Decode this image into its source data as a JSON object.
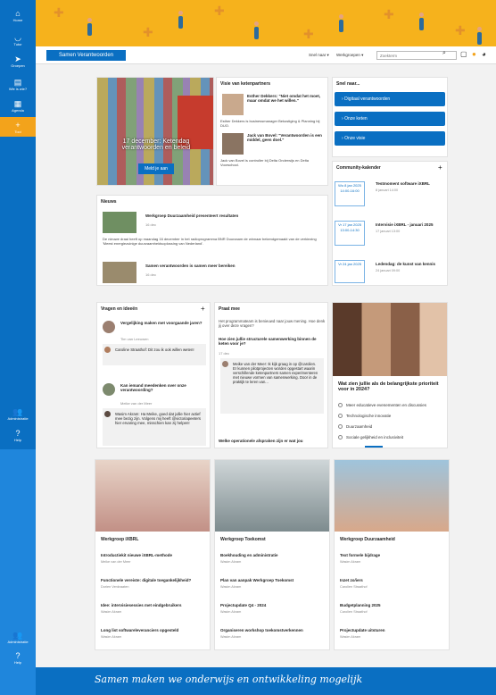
{
  "rail": {
    "items": [
      {
        "label": "Home",
        "icon": "home-icon",
        "glyph": "⌂"
      },
      {
        "label": "Tutor",
        "icon": "headset-icon",
        "glyph": "◡"
      },
      {
        "label": "Groepen",
        "icon": "send-icon",
        "glyph": "➤"
      },
      {
        "label": "Wie is wie?",
        "icon": "id-card-icon",
        "glyph": "▤"
      },
      {
        "label": "Agenda",
        "icon": "calendar-icon",
        "glyph": "▦"
      },
      {
        "label": "Tool",
        "icon": "plus-icon",
        "glyph": "+"
      }
    ],
    "admin_label": "Administratie",
    "help_label": "Help",
    "admin_label_2": "Administratie",
    "help_label_2": "Help",
    "active_color": "#f3a31b",
    "rail_color": "#0a6fc2"
  },
  "topbar": {
    "site_title": "Samen Verantwoorden",
    "snel_naar": "Snel naar ▾",
    "werkgroepen": "Werkgroepen ▾",
    "search_placeholder": "Zoekterm"
  },
  "hero": {
    "title": "17 december: Ketendag verantwoorden en beleid",
    "button": "Meld je aan"
  },
  "visie": {
    "heading": "Visie van ketenpartners",
    "q1": "Esther Dekkers: \"Niet omdat het moet, maar omdat we het willen.\"",
    "d1": "Esther Dekkers is businessmanager Bekostiging & Planning bij DUO.",
    "q2": "Jack van Bovel: \"Verantwoorden is een middel, geen doel.\"",
    "d2": "Jack van Bovel is controller bij Delta Onderwijs en Delta Voorschool."
  },
  "nieuws": {
    "heading": "Nieuws",
    "items": [
      {
        "title": "Werkgroep Duurzaamheid presenteert resultaten",
        "date": "16 dec",
        "excerpt": "De nieuwe draai heeft op maandag 16 december in het radioprogramma BNR Duurzaam de winnaar bekendgemaakt van de verkiezing 'Meest energiezuinige duurzaamheidsoplossing van Nederland'."
      },
      {
        "title": "Samen verantwoorden is samen meer bereiken",
        "date": "16 dec"
      }
    ]
  },
  "snel": {
    "heading": "Snel naar...",
    "buttons": [
      "Digitaal verantwoorden",
      "Onze keten",
      "Onze visie"
    ]
  },
  "kalender": {
    "heading": "Community-kalender",
    "events": [
      {
        "date": "Wo 8 jan 2025 14:00-16:00",
        "title": "Testmoment software iXBRL",
        "time": "8 januari 14:00"
      },
      {
        "date": "Vr 17 jan 2025 13:00-14:30",
        "title": "Intervisie iXBRL - januari 2025",
        "time": "17 januari 13:00"
      },
      {
        "date": "Vr 24 jan 2025",
        "title": "Ledendag: de kunst van kennis",
        "time": "24 januari 09:00"
      }
    ]
  },
  "vragen": {
    "heading": "Vragen en ideeën",
    "items": [
      {
        "title": "Vergelijking maken met voorgaande jaren?",
        "meta": "Tim van Leeuwen"
      },
      {
        "reply": "Caroline Straathof: Dit zou ik ook willen weten!"
      },
      {
        "title": "Kan iemand meedenken over onze verantwoording?",
        "meta": "Meike van der Meer"
      },
      {
        "reply": "Wasim Akram: Ha Meike, goed dat jullie hier actief mee bezig zijn. Volgens mij heeft @victoriapeeters hier ervaring mee, misschien kan zij helpen!"
      }
    ]
  },
  "praat": {
    "heading": "Praat mee",
    "intro": "Het programmateam is benieuwd naar jouw mening. Hoe denk jij over deze vragen?",
    "q": "Hoe zien jullie structurele samenwerking binnen de keten voor je?",
    "date": "17 dec",
    "reply": "Meike van der Meer: Ik kijk graag in op @carolien. Er kunnen pilotprojecten worden opgestart waarin verschillende ketenpartners samen experimenteren met nieuwe vormen van samenwerking. Door in de praktijk te leren van...",
    "q2": "Welke operationele afspraken zijn er wat jou"
  },
  "poll": {
    "question": "Wat zien jullie als de belangrijkste prioriteit voor in 2024?",
    "options": [
      "Meer educatieve evenementen en discussies",
      "Technologische innovatie",
      "Duurzaamheid",
      "Sociale gelijkheid en inclusiviteit"
    ]
  },
  "werkgroepen": [
    {
      "title": "Werkgroep iXBRL",
      "items": [
        {
          "t": "Introductiekit nieuwe iXBRL-methode",
          "a": "Meike van der Meer"
        },
        {
          "t": "Functionele vereiste: digitale toegankelijkheid?",
          "a": "Dorien Venkraaten"
        },
        {
          "t": "Idee: intervisiesessies met eindgebruikers",
          "a": "Wasim Akram"
        },
        {
          "t": "Long list softwareleveranciers opgesteld",
          "a": "Wasim Akram"
        }
      ]
    },
    {
      "title": "Werkgroep Toekomst",
      "items": [
        {
          "t": "Boekhouding en administratie",
          "a": "Wasim Akram"
        },
        {
          "t": "Plan van aanpak Werkgroep Toekomst",
          "a": "Wasim Akram"
        },
        {
          "t": "Projectupdate Q4 - 2024",
          "a": "Wasim Akram"
        },
        {
          "t": "Organiseren workshop toekomstverkennen",
          "a": "Wasim Akram"
        }
      ]
    },
    {
      "title": "Werkgroep Duurzaamheid",
      "items": [
        {
          "t": "Text formele bijdrage",
          "a": "Wasim Akram"
        },
        {
          "t": "Inzet zo/iers",
          "a": "Carolien Straathof"
        },
        {
          "t": "Budgetplanning 2025",
          "a": "Carolien Straathof"
        },
        {
          "t": "Projectupdate uitsturen",
          "a": "Wasim Akram"
        }
      ]
    }
  ],
  "footer": {
    "tagline": "Samen maken we onderwijs en ontwikkeling mogelijk"
  }
}
